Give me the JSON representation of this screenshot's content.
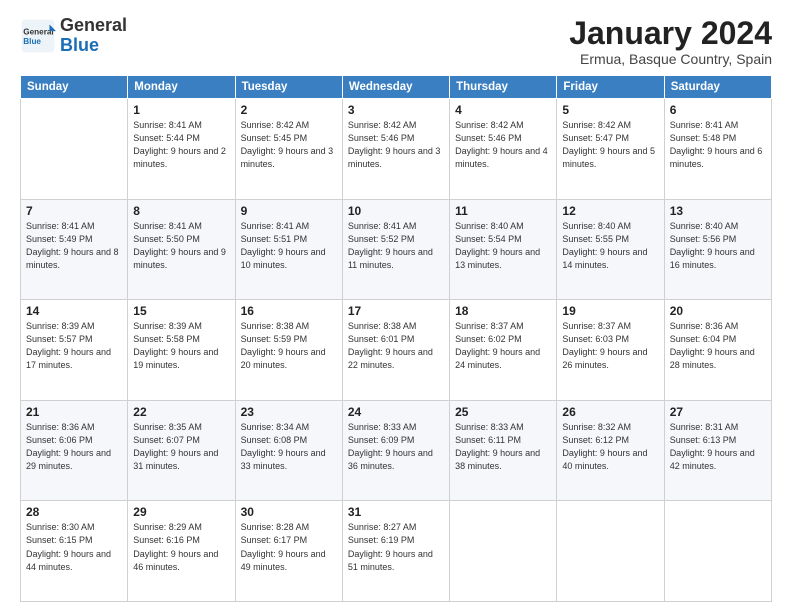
{
  "header": {
    "logo_general": "General",
    "logo_blue": "Blue",
    "title": "January 2024",
    "location": "Ermua, Basque Country, Spain"
  },
  "days_of_week": [
    "Sunday",
    "Monday",
    "Tuesday",
    "Wednesday",
    "Thursday",
    "Friday",
    "Saturday"
  ],
  "weeks": [
    [
      {
        "day": "",
        "info": ""
      },
      {
        "day": "1",
        "info": "Sunrise: 8:41 AM\nSunset: 5:44 PM\nDaylight: 9 hours\nand 2 minutes."
      },
      {
        "day": "2",
        "info": "Sunrise: 8:42 AM\nSunset: 5:45 PM\nDaylight: 9 hours\nand 3 minutes."
      },
      {
        "day": "3",
        "info": "Sunrise: 8:42 AM\nSunset: 5:46 PM\nDaylight: 9 hours\nand 3 minutes."
      },
      {
        "day": "4",
        "info": "Sunrise: 8:42 AM\nSunset: 5:46 PM\nDaylight: 9 hours\nand 4 minutes."
      },
      {
        "day": "5",
        "info": "Sunrise: 8:42 AM\nSunset: 5:47 PM\nDaylight: 9 hours\nand 5 minutes."
      },
      {
        "day": "6",
        "info": "Sunrise: 8:41 AM\nSunset: 5:48 PM\nDaylight: 9 hours\nand 6 minutes."
      }
    ],
    [
      {
        "day": "7",
        "info": "Sunrise: 8:41 AM\nSunset: 5:49 PM\nDaylight: 9 hours\nand 8 minutes."
      },
      {
        "day": "8",
        "info": "Sunrise: 8:41 AM\nSunset: 5:50 PM\nDaylight: 9 hours\nand 9 minutes."
      },
      {
        "day": "9",
        "info": "Sunrise: 8:41 AM\nSunset: 5:51 PM\nDaylight: 9 hours\nand 10 minutes."
      },
      {
        "day": "10",
        "info": "Sunrise: 8:41 AM\nSunset: 5:52 PM\nDaylight: 9 hours\nand 11 minutes."
      },
      {
        "day": "11",
        "info": "Sunrise: 8:40 AM\nSunset: 5:54 PM\nDaylight: 9 hours\nand 13 minutes."
      },
      {
        "day": "12",
        "info": "Sunrise: 8:40 AM\nSunset: 5:55 PM\nDaylight: 9 hours\nand 14 minutes."
      },
      {
        "day": "13",
        "info": "Sunrise: 8:40 AM\nSunset: 5:56 PM\nDaylight: 9 hours\nand 16 minutes."
      }
    ],
    [
      {
        "day": "14",
        "info": "Sunrise: 8:39 AM\nSunset: 5:57 PM\nDaylight: 9 hours\nand 17 minutes."
      },
      {
        "day": "15",
        "info": "Sunrise: 8:39 AM\nSunset: 5:58 PM\nDaylight: 9 hours\nand 19 minutes."
      },
      {
        "day": "16",
        "info": "Sunrise: 8:38 AM\nSunset: 5:59 PM\nDaylight: 9 hours\nand 20 minutes."
      },
      {
        "day": "17",
        "info": "Sunrise: 8:38 AM\nSunset: 6:01 PM\nDaylight: 9 hours\nand 22 minutes."
      },
      {
        "day": "18",
        "info": "Sunrise: 8:37 AM\nSunset: 6:02 PM\nDaylight: 9 hours\nand 24 minutes."
      },
      {
        "day": "19",
        "info": "Sunrise: 8:37 AM\nSunset: 6:03 PM\nDaylight: 9 hours\nand 26 minutes."
      },
      {
        "day": "20",
        "info": "Sunrise: 8:36 AM\nSunset: 6:04 PM\nDaylight: 9 hours\nand 28 minutes."
      }
    ],
    [
      {
        "day": "21",
        "info": "Sunrise: 8:36 AM\nSunset: 6:06 PM\nDaylight: 9 hours\nand 29 minutes."
      },
      {
        "day": "22",
        "info": "Sunrise: 8:35 AM\nSunset: 6:07 PM\nDaylight: 9 hours\nand 31 minutes."
      },
      {
        "day": "23",
        "info": "Sunrise: 8:34 AM\nSunset: 6:08 PM\nDaylight: 9 hours\nand 33 minutes."
      },
      {
        "day": "24",
        "info": "Sunrise: 8:33 AM\nSunset: 6:09 PM\nDaylight: 9 hours\nand 36 minutes."
      },
      {
        "day": "25",
        "info": "Sunrise: 8:33 AM\nSunset: 6:11 PM\nDaylight: 9 hours\nand 38 minutes."
      },
      {
        "day": "26",
        "info": "Sunrise: 8:32 AM\nSunset: 6:12 PM\nDaylight: 9 hours\nand 40 minutes."
      },
      {
        "day": "27",
        "info": "Sunrise: 8:31 AM\nSunset: 6:13 PM\nDaylight: 9 hours\nand 42 minutes."
      }
    ],
    [
      {
        "day": "28",
        "info": "Sunrise: 8:30 AM\nSunset: 6:15 PM\nDaylight: 9 hours\nand 44 minutes."
      },
      {
        "day": "29",
        "info": "Sunrise: 8:29 AM\nSunset: 6:16 PM\nDaylight: 9 hours\nand 46 minutes."
      },
      {
        "day": "30",
        "info": "Sunrise: 8:28 AM\nSunset: 6:17 PM\nDaylight: 9 hours\nand 49 minutes."
      },
      {
        "day": "31",
        "info": "Sunrise: 8:27 AM\nSunset: 6:19 PM\nDaylight: 9 hours\nand 51 minutes."
      },
      {
        "day": "",
        "info": ""
      },
      {
        "day": "",
        "info": ""
      },
      {
        "day": "",
        "info": ""
      }
    ]
  ]
}
